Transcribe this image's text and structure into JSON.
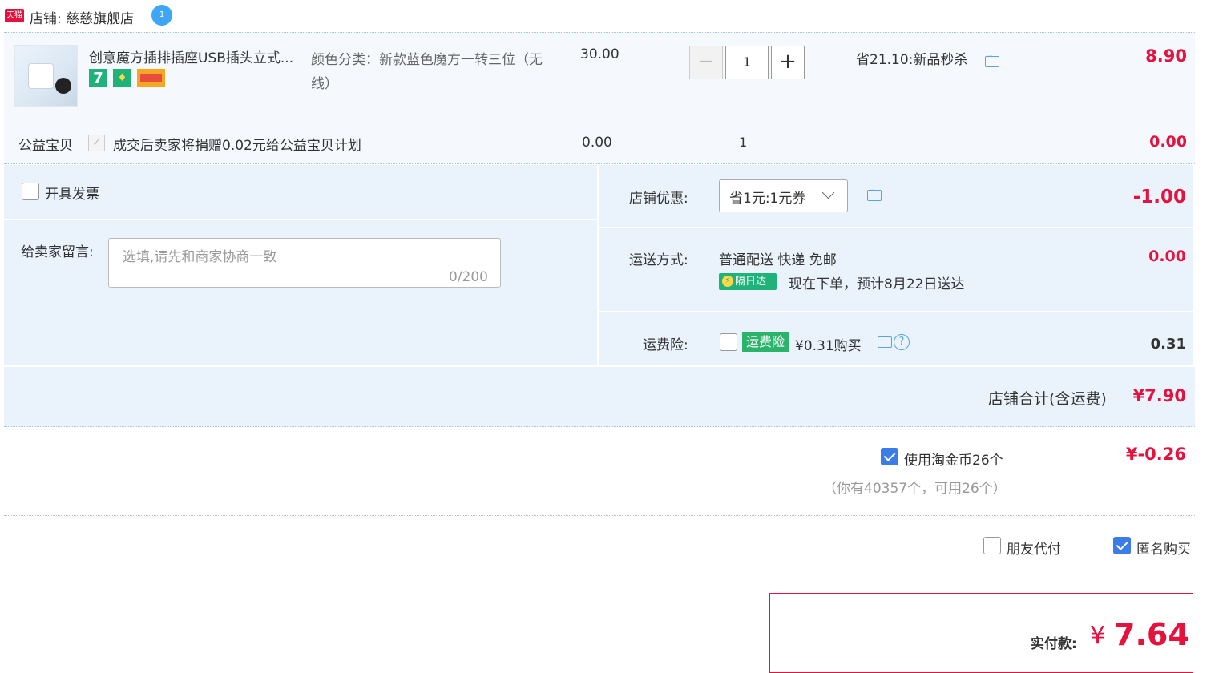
{
  "shop": {
    "platform_badge": "天猫",
    "label": "店铺: 慈慈旗舰店",
    "wangwang_icon": "chat-bubble-icon"
  },
  "item": {
    "title": "创意魔方插排插座USB插头立式...",
    "badges": [
      "7"
    ],
    "sku": "颜色分类：新款蓝色魔方一转三位（无线）",
    "unit_price": "30.00",
    "quantity": "1",
    "promo": "省21.10:新品秒杀",
    "total": "8.90"
  },
  "charity": {
    "label": "公益宝贝",
    "text": "成交后卖家将捐赠0.02元给公益宝贝计划",
    "price": "0.00",
    "qty": "1",
    "total": "0.00"
  },
  "invoice": {
    "label": "开具发票",
    "checked": false
  },
  "message": {
    "label": "给卖家留言:",
    "placeholder": "选填,请先和商家协商一致",
    "count": "0/200"
  },
  "discount": {
    "label": "店铺优惠:",
    "selected": "省1元:1元券",
    "amount": "-1.00"
  },
  "shipping": {
    "label": "运送方式:",
    "method": "普通配送 快递 免邮",
    "next_day_badge": "隔日达",
    "eta": "现在下单，预计8月22日送达",
    "amount": "0.00"
  },
  "insurance": {
    "label": "运费险:",
    "badge": "运费险",
    "price": "¥0.31购买",
    "help": "?",
    "amount": "0.31"
  },
  "shop_total": {
    "label": "店铺合计(含运费)",
    "value": "¥7.90"
  },
  "coins": {
    "text": "使用淘金币26个",
    "sub": "（你有40357个，可用26个）",
    "amount": "¥-0.26",
    "checked": true
  },
  "options": {
    "friend_pay": "朋友代付",
    "anonymous": "匿名购买"
  },
  "payment": {
    "label": "实付款:",
    "currency": "¥",
    "value": "7.64"
  },
  "colors": {
    "accent_red": "#e4123d",
    "panel_blue": "#eaf3fc",
    "green": "#1fb37a",
    "check_blue": "#3b7ce8"
  }
}
